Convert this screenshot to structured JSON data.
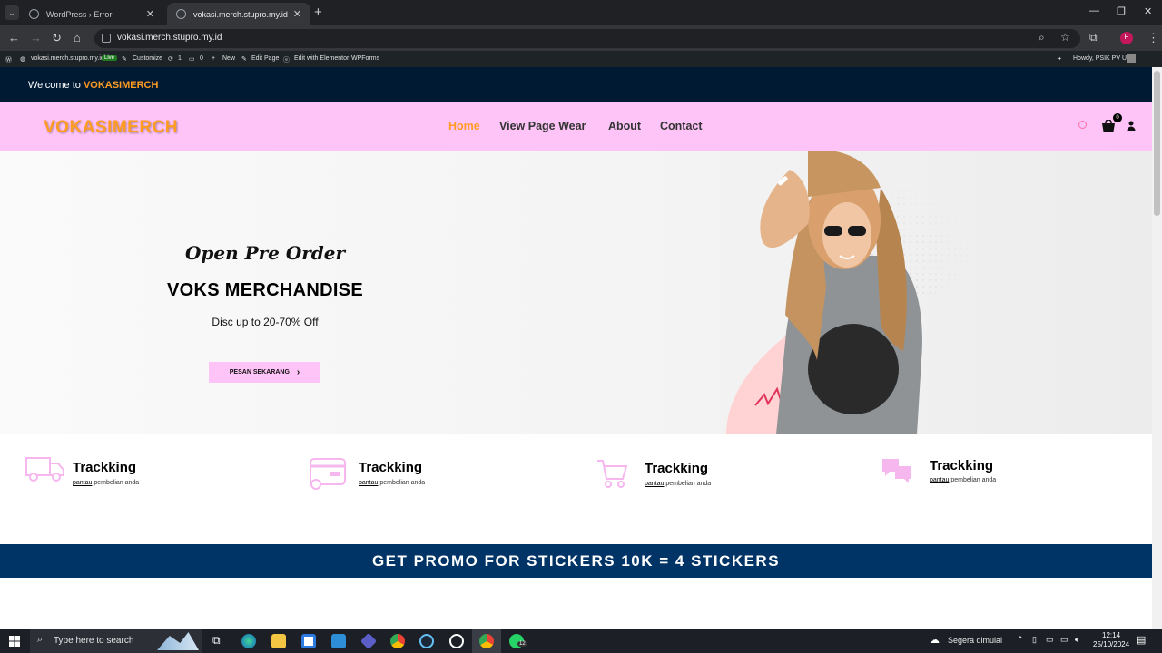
{
  "browser": {
    "tabs": [
      {
        "label": "WordPress › Error",
        "active": false
      },
      {
        "label": "vokasi.merch.stupro.my.id",
        "active": true
      }
    ],
    "url": "vokasi.merch.stupro.my.id"
  },
  "wp_admin_bar": {
    "site": "vokasi.merch.stupro.my.id",
    "live_badge": "Live",
    "customize": "Customize",
    "updates": "1",
    "comments": "0",
    "new": "New",
    "edit_page": "Edit Page",
    "edit_elementor": "Edit with Elementor",
    "wpforms": "WPForms",
    "howdy": "Howdy, PSIK PV UB"
  },
  "topstrip": {
    "welcome": "Welcome to",
    "brand": "VOKASIMERCH"
  },
  "header": {
    "logo": "VOKASIMERCH",
    "nav": [
      "Home",
      "View Page Wear",
      "About",
      "Contact"
    ],
    "cart_count": "0"
  },
  "hero": {
    "pre_title": "Open Pre Order",
    "title": "VOKS MERCHANDISE",
    "discount": "Disc up to 20-70% Off",
    "button": "PESAN SEKARANG",
    "button_arrow": "›"
  },
  "features": [
    {
      "icon": "truck-icon",
      "title": "Trackking",
      "sub_u": "pantau",
      "sub": " pembelian anda"
    },
    {
      "icon": "card-icon",
      "title": "Trackking",
      "sub_u": "pantau",
      "sub": " pembelian anda"
    },
    {
      "icon": "cart-icon",
      "title": "Trackking",
      "sub_u": "pantau",
      "sub": " pembelian anda"
    },
    {
      "icon": "chat-icon",
      "title": "Trackking",
      "sub_u": "pantau",
      "sub": " pembelian anda"
    }
  ],
  "promo": {
    "text": "GET PROMO FOR STICKERS 10K = 4 STICKERS"
  },
  "taskbar": {
    "search_placeholder": "Type here to search",
    "weather": "Segera dimulai",
    "time": "12:14",
    "date": "25/10/2024",
    "whatsapp_badge": "12"
  },
  "colors": {
    "accent": "#ff9c23",
    "pink": "#ffc4f7",
    "navy": "#003366",
    "topstrip": "#001a33"
  }
}
